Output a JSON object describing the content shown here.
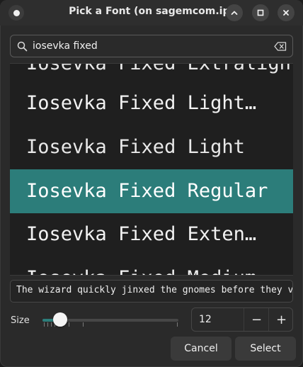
{
  "window": {
    "title": "Pick a Font (on sagemcom.ip)"
  },
  "icons": {
    "app": "app-dot-icon",
    "minimize": "chevron-up-icon",
    "maximize": "square-icon",
    "close": "close-icon",
    "search": "search-icon",
    "clear": "backspace-clear-icon"
  },
  "search": {
    "value": "iosevka fixed"
  },
  "font_list": [
    {
      "label": "Iosevka Fixed Extralight",
      "selected": false
    },
    {
      "label": "Iosevka Fixed Light…",
      "selected": false
    },
    {
      "label": "Iosevka Fixed Light",
      "selected": false
    },
    {
      "label": "Iosevka Fixed Regular",
      "selected": true
    },
    {
      "label": "Iosevka Fixed Exten…",
      "selected": false
    },
    {
      "label": "Iosevka Fixed Medium",
      "selected": false
    }
  ],
  "preview": {
    "text": "The wizard quickly jinxed the gnomes before they vaporized."
  },
  "size": {
    "label": "Size",
    "value": "12",
    "slider_fraction": 0.08,
    "decrement": "−",
    "increment": "+"
  },
  "buttons": {
    "cancel": "Cancel",
    "select": "Select"
  },
  "colors": {
    "accent": "#2c7d7a",
    "window_bg": "#2a2a2a",
    "list_bg": "#1f1f1f"
  }
}
